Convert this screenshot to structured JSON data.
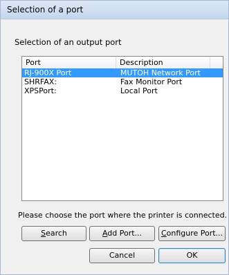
{
  "window": {
    "title": "Selection of a port"
  },
  "section_label": "Selection of an output port",
  "port_list": {
    "columns": [
      "Port",
      "Description"
    ],
    "rows": [
      {
        "port": "RJ-900X Port",
        "description": "MUTOH Network Port",
        "selected": true
      },
      {
        "port": "SHRFAX:",
        "description": "Fax Monitor Port",
        "selected": false
      },
      {
        "port": "XPSPort:",
        "description": "Local Port",
        "selected": false
      }
    ]
  },
  "hint": "Please choose the port where the printer is connected.",
  "buttons": {
    "search": {
      "mnemonic": "S",
      "rest": "earch"
    },
    "add_port": {
      "mnemonic": "A",
      "rest": "dd Port..."
    },
    "configure_port": {
      "mnemonic": "C",
      "rest": "onfigure Port..."
    },
    "cancel": "Cancel",
    "ok": "OK"
  },
  "colors": {
    "selection": "#3399ff",
    "titlebar": "#c4d7ee"
  }
}
